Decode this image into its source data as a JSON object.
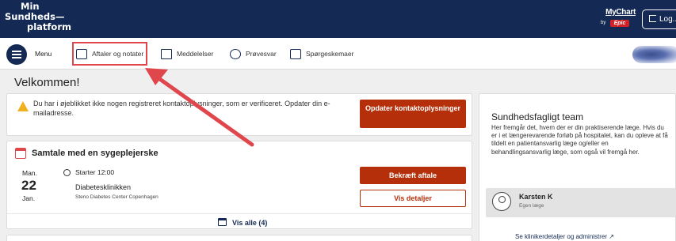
{
  "header": {
    "logo_line1": "Min",
    "logo_line2": "Sundheds—",
    "logo_line3": "platform",
    "mychart": "MyChart",
    "mychart_by": "by",
    "epic": "Epic",
    "logout": "Log..."
  },
  "nav": {
    "menu": "Menu",
    "items": [
      {
        "label": "Aftaler og notater",
        "icon": "calendar-icon"
      },
      {
        "label": "Meddelelser",
        "icon": "envelope-icon"
      },
      {
        "label": "Prøvesvar",
        "icon": "flask-icon"
      },
      {
        "label": "Spørgeskemaer",
        "icon": "clipboard-icon"
      }
    ]
  },
  "welcome": "Velkommen!",
  "notice": {
    "text": "Du har i øjeblikket ikke nogen registreret kontaktoplysninger, som er verificeret. Opdater din e-mailadresse.",
    "button": "Opdater kontaktoplysninger"
  },
  "appointment": {
    "title": "Samtale med en sygeplejerske",
    "dow": "Man.",
    "day": "22",
    "month": "Jan.",
    "time": "Starter 12:00",
    "department": "Diabetesklinikken",
    "location": "Steno Diabetes Center Copenhagen",
    "confirm": "Bekræft aftale",
    "details": "Vis detaljer",
    "see_all": "Vis alle (4)"
  },
  "team": {
    "title": "Sundhedsfagligt team",
    "description": "Her fremgår det, hvem der er din praktiserende læge. Hvis du er i et længerevarende forløb på hospitalet, kan du opleve at få tildelt en patientansvarlig læge og/eller en behandlingsansvarlig læge, som også vil fremgå her.",
    "clinician_name": "Karsten K",
    "clinician_role": "Egen læge",
    "link": "Se klinikerdetaljer og administrer ↗"
  },
  "colors": {
    "header_bg": "#142a54",
    "accent_red": "#b5300a",
    "highlight": "#e0474c",
    "warning": "#f2b01e"
  }
}
